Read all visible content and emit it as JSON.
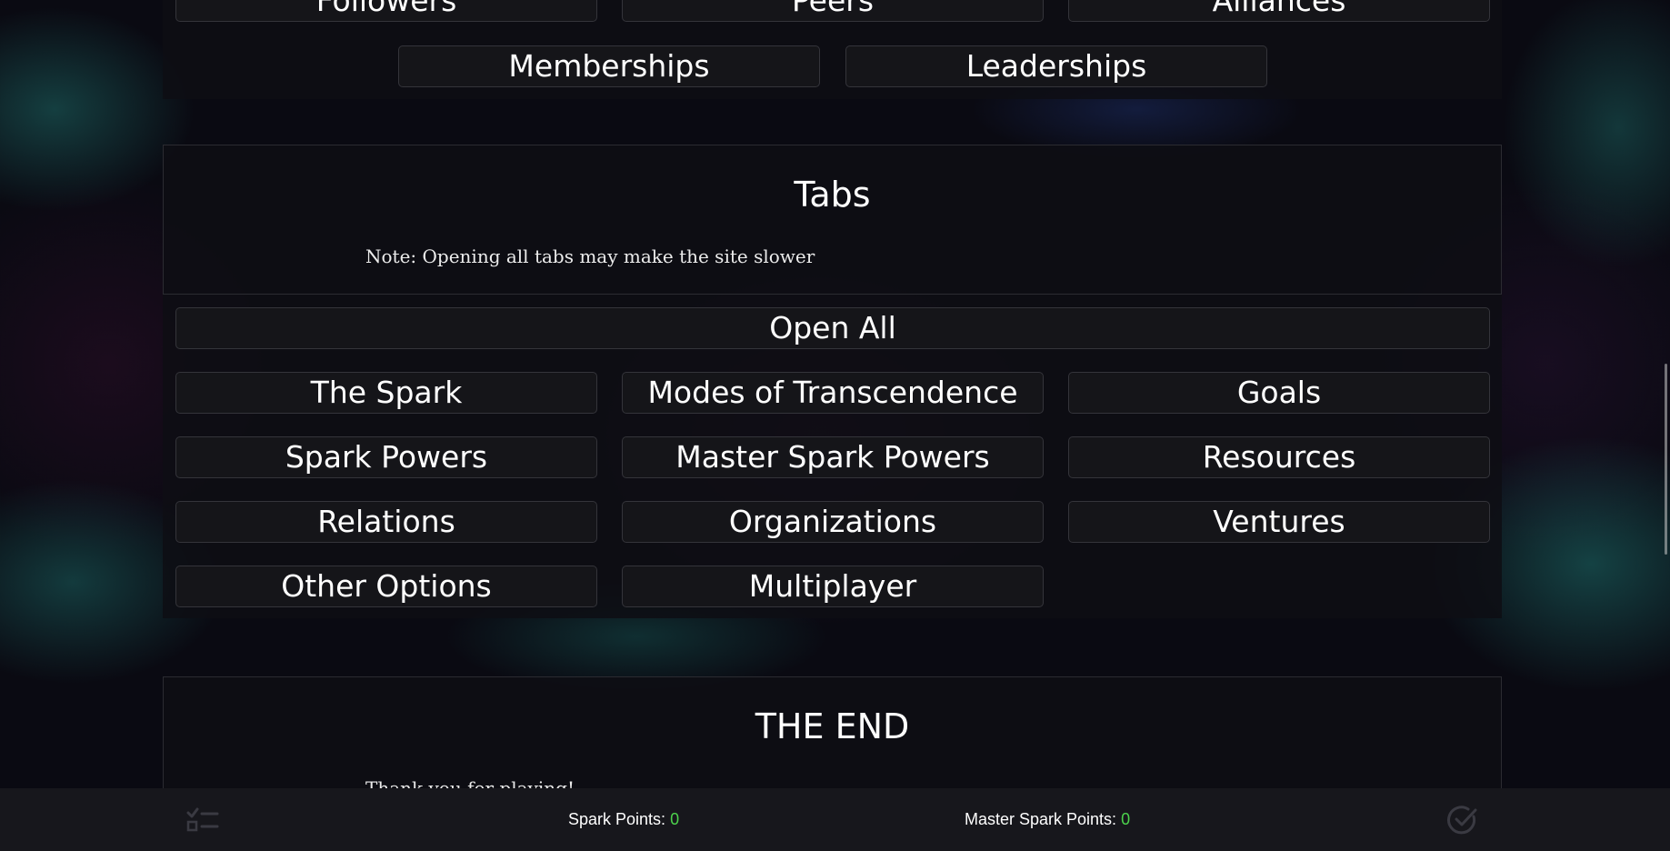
{
  "top_section": {
    "partial_row": [
      "Followers",
      "Peers",
      "Alliances"
    ],
    "row": [
      "Memberships",
      "Leaderships"
    ]
  },
  "tabs_section": {
    "title": "Tabs",
    "note": "Note: Opening all tabs may make the site slower",
    "open_all_label": "Open All",
    "buttons": [
      "The Spark",
      "Modes of Transcendence",
      "Goals",
      "Spark Powers",
      "Master Spark Powers",
      "Resources",
      "Relations",
      "Organizations",
      "Ventures",
      "Other Options",
      "Multiplayer"
    ]
  },
  "end_section": {
    "title": "THE END",
    "note": "Thank you for playing!"
  },
  "footer": {
    "spark_points_label": "Spark Points:",
    "spark_points_value": "0",
    "master_spark_points_label": "Master Spark Points:",
    "master_spark_points_value": "0",
    "left_icon": "checklist-icon",
    "right_icon": "check-circle-icon"
  },
  "colors": {
    "accent_value": "#4cd24c",
    "panel_bg": "#0e0e14",
    "button_border": "#34343a"
  }
}
